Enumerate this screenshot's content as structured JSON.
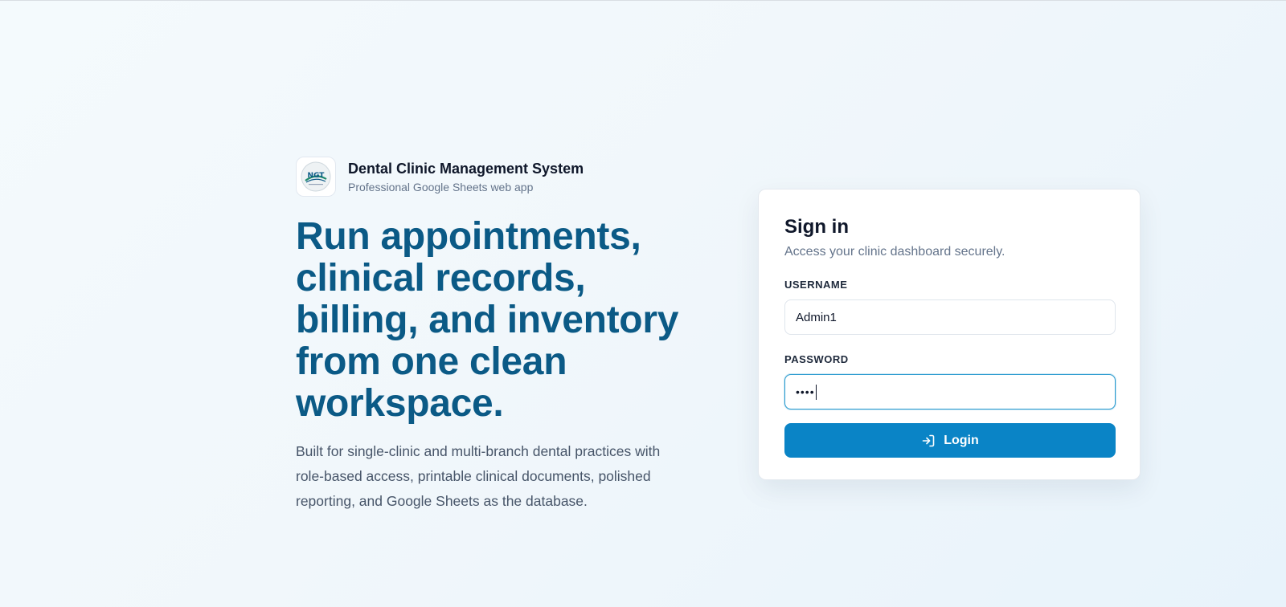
{
  "brand": {
    "logo_text": "NGT",
    "title": "Dental Clinic Management System",
    "subtitle": "Professional Google Sheets web app"
  },
  "hero": {
    "headline": "Run appointments, clinical records, billing, and inventory from one clean workspace.",
    "description": "Built for single-clinic and multi-branch dental practices with role-based access, printable clinical documents, polished reporting, and Google Sheets as the database."
  },
  "signin": {
    "title": "Sign in",
    "subtitle": "Access your clinic dashboard securely.",
    "username_label": "USERNAME",
    "username_value": "Admin1",
    "password_label": "PASSWORD",
    "password_masked": "••••",
    "login_label": "Login",
    "login_icon": "login-icon"
  },
  "colors": {
    "accent": "#0a84c6",
    "headline": "#0b5a86",
    "focus_border": "#2b9bcf"
  }
}
